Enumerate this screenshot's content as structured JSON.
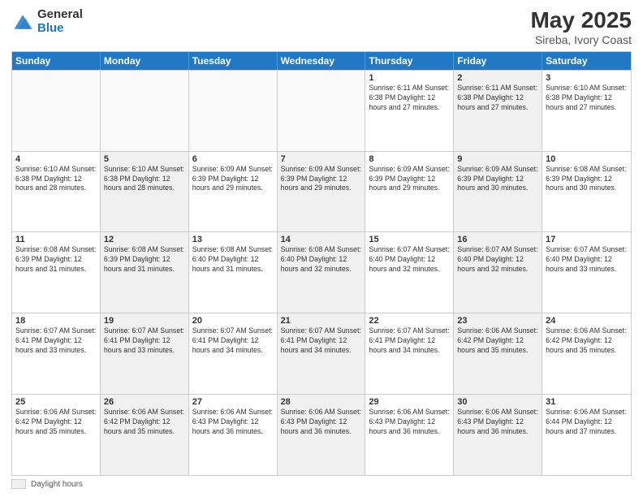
{
  "logo": {
    "general": "General",
    "blue": "Blue"
  },
  "title": "May 2025",
  "location": "Sireba, Ivory Coast",
  "days_of_week": [
    "Sunday",
    "Monday",
    "Tuesday",
    "Wednesday",
    "Thursday",
    "Friday",
    "Saturday"
  ],
  "footer": {
    "label": "Daylight hours"
  },
  "weeks": [
    [
      {
        "day": "",
        "info": "",
        "empty": true
      },
      {
        "day": "",
        "info": "",
        "empty": true
      },
      {
        "day": "",
        "info": "",
        "empty": true
      },
      {
        "day": "",
        "info": "",
        "empty": true
      },
      {
        "day": "1",
        "info": "Sunrise: 6:11 AM\nSunset: 6:38 PM\nDaylight: 12 hours\nand 27 minutes.",
        "shaded": false
      },
      {
        "day": "2",
        "info": "Sunrise: 6:11 AM\nSunset: 6:38 PM\nDaylight: 12 hours\nand 27 minutes.",
        "shaded": true
      },
      {
        "day": "3",
        "info": "Sunrise: 6:10 AM\nSunset: 6:38 PM\nDaylight: 12 hours\nand 27 minutes.",
        "shaded": false
      }
    ],
    [
      {
        "day": "4",
        "info": "Sunrise: 6:10 AM\nSunset: 6:38 PM\nDaylight: 12 hours\nand 28 minutes.",
        "shaded": false
      },
      {
        "day": "5",
        "info": "Sunrise: 6:10 AM\nSunset: 6:38 PM\nDaylight: 12 hours\nand 28 minutes.",
        "shaded": true
      },
      {
        "day": "6",
        "info": "Sunrise: 6:09 AM\nSunset: 6:39 PM\nDaylight: 12 hours\nand 29 minutes.",
        "shaded": false
      },
      {
        "day": "7",
        "info": "Sunrise: 6:09 AM\nSunset: 6:39 PM\nDaylight: 12 hours\nand 29 minutes.",
        "shaded": true
      },
      {
        "day": "8",
        "info": "Sunrise: 6:09 AM\nSunset: 6:39 PM\nDaylight: 12 hours\nand 29 minutes.",
        "shaded": false
      },
      {
        "day": "9",
        "info": "Sunrise: 6:09 AM\nSunset: 6:39 PM\nDaylight: 12 hours\nand 30 minutes.",
        "shaded": true
      },
      {
        "day": "10",
        "info": "Sunrise: 6:08 AM\nSunset: 6:39 PM\nDaylight: 12 hours\nand 30 minutes.",
        "shaded": false
      }
    ],
    [
      {
        "day": "11",
        "info": "Sunrise: 6:08 AM\nSunset: 6:39 PM\nDaylight: 12 hours\nand 31 minutes.",
        "shaded": false
      },
      {
        "day": "12",
        "info": "Sunrise: 6:08 AM\nSunset: 6:39 PM\nDaylight: 12 hours\nand 31 minutes.",
        "shaded": true
      },
      {
        "day": "13",
        "info": "Sunrise: 6:08 AM\nSunset: 6:40 PM\nDaylight: 12 hours\nand 31 minutes.",
        "shaded": false
      },
      {
        "day": "14",
        "info": "Sunrise: 6:08 AM\nSunset: 6:40 PM\nDaylight: 12 hours\nand 32 minutes.",
        "shaded": true
      },
      {
        "day": "15",
        "info": "Sunrise: 6:07 AM\nSunset: 6:40 PM\nDaylight: 12 hours\nand 32 minutes.",
        "shaded": false
      },
      {
        "day": "16",
        "info": "Sunrise: 6:07 AM\nSunset: 6:40 PM\nDaylight: 12 hours\nand 32 minutes.",
        "shaded": true
      },
      {
        "day": "17",
        "info": "Sunrise: 6:07 AM\nSunset: 6:40 PM\nDaylight: 12 hours\nand 33 minutes.",
        "shaded": false
      }
    ],
    [
      {
        "day": "18",
        "info": "Sunrise: 6:07 AM\nSunset: 6:41 PM\nDaylight: 12 hours\nand 33 minutes.",
        "shaded": false
      },
      {
        "day": "19",
        "info": "Sunrise: 6:07 AM\nSunset: 6:41 PM\nDaylight: 12 hours\nand 33 minutes.",
        "shaded": true
      },
      {
        "day": "20",
        "info": "Sunrise: 6:07 AM\nSunset: 6:41 PM\nDaylight: 12 hours\nand 34 minutes.",
        "shaded": false
      },
      {
        "day": "21",
        "info": "Sunrise: 6:07 AM\nSunset: 6:41 PM\nDaylight: 12 hours\nand 34 minutes.",
        "shaded": true
      },
      {
        "day": "22",
        "info": "Sunrise: 6:07 AM\nSunset: 6:41 PM\nDaylight: 12 hours\nand 34 minutes.",
        "shaded": false
      },
      {
        "day": "23",
        "info": "Sunrise: 6:06 AM\nSunset: 6:42 PM\nDaylight: 12 hours\nand 35 minutes.",
        "shaded": true
      },
      {
        "day": "24",
        "info": "Sunrise: 6:06 AM\nSunset: 6:42 PM\nDaylight: 12 hours\nand 35 minutes.",
        "shaded": false
      }
    ],
    [
      {
        "day": "25",
        "info": "Sunrise: 6:06 AM\nSunset: 6:42 PM\nDaylight: 12 hours\nand 35 minutes.",
        "shaded": false
      },
      {
        "day": "26",
        "info": "Sunrise: 6:06 AM\nSunset: 6:42 PM\nDaylight: 12 hours\nand 35 minutes.",
        "shaded": true
      },
      {
        "day": "27",
        "info": "Sunrise: 6:06 AM\nSunset: 6:43 PM\nDaylight: 12 hours\nand 36 minutes.",
        "shaded": false
      },
      {
        "day": "28",
        "info": "Sunrise: 6:06 AM\nSunset: 6:43 PM\nDaylight: 12 hours\nand 36 minutes.",
        "shaded": true
      },
      {
        "day": "29",
        "info": "Sunrise: 6:06 AM\nSunset: 6:43 PM\nDaylight: 12 hours\nand 36 minutes.",
        "shaded": false
      },
      {
        "day": "30",
        "info": "Sunrise: 6:06 AM\nSunset: 6:43 PM\nDaylight: 12 hours\nand 36 minutes.",
        "shaded": true
      },
      {
        "day": "31",
        "info": "Sunrise: 6:06 AM\nSunset: 6:44 PM\nDaylight: 12 hours\nand 37 minutes.",
        "shaded": false
      }
    ]
  ]
}
